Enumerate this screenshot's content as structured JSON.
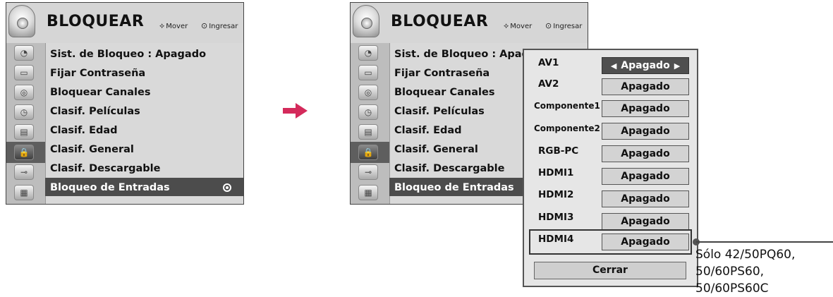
{
  "menu": {
    "title": "BLOQUEAR",
    "hint_move": "Mover",
    "hint_enter": "Ingresar",
    "items": [
      "Sist. de Bloqueo : Apagado",
      "Fijar Contraseña",
      "Bloquear Canales",
      "Clasif. Películas",
      "Clasif. Edad",
      "Clasif. General",
      "Clasif. Descargable",
      "Bloqueo de Entradas"
    ],
    "items_right_truncated_first": "Sist. de Bloqueo : Apag",
    "selected_item": "Bloqueo de Entradas",
    "sidebar_icons": [
      "satellite-dish-icon",
      "tv-screen-icon",
      "speaker-icon",
      "clock-icon",
      "picture-icon",
      "lock-icon",
      "plug-icon",
      "settings-box-icon"
    ]
  },
  "popup": {
    "rows": [
      {
        "label": "AV1",
        "value": "Apagado",
        "active": true
      },
      {
        "label": "AV2",
        "value": "Apagado",
        "active": false
      },
      {
        "label": "Componente1",
        "value": "Apagado",
        "active": false
      },
      {
        "label": "Componente2",
        "value": "Apagado",
        "active": false
      },
      {
        "label": "RGB-PC",
        "value": "Apagado",
        "active": false
      },
      {
        "label": "HDMI1",
        "value": "Apagado",
        "active": false
      },
      {
        "label": "HDMI2",
        "value": "Apagado",
        "active": false
      },
      {
        "label": "HDMI3",
        "value": "Apagado",
        "active": false
      },
      {
        "label": "HDMI4",
        "value": "Apagado",
        "active": false
      }
    ],
    "close_label": "Cerrar"
  },
  "callout": {
    "lines": [
      "Sólo 42/50PQ60,",
      "50/60PS60,",
      "50/60PS60C"
    ]
  },
  "colors": {
    "arrow": "#d42a5b",
    "selection": "#4c4c4c",
    "panel": "#d9d9d9"
  }
}
